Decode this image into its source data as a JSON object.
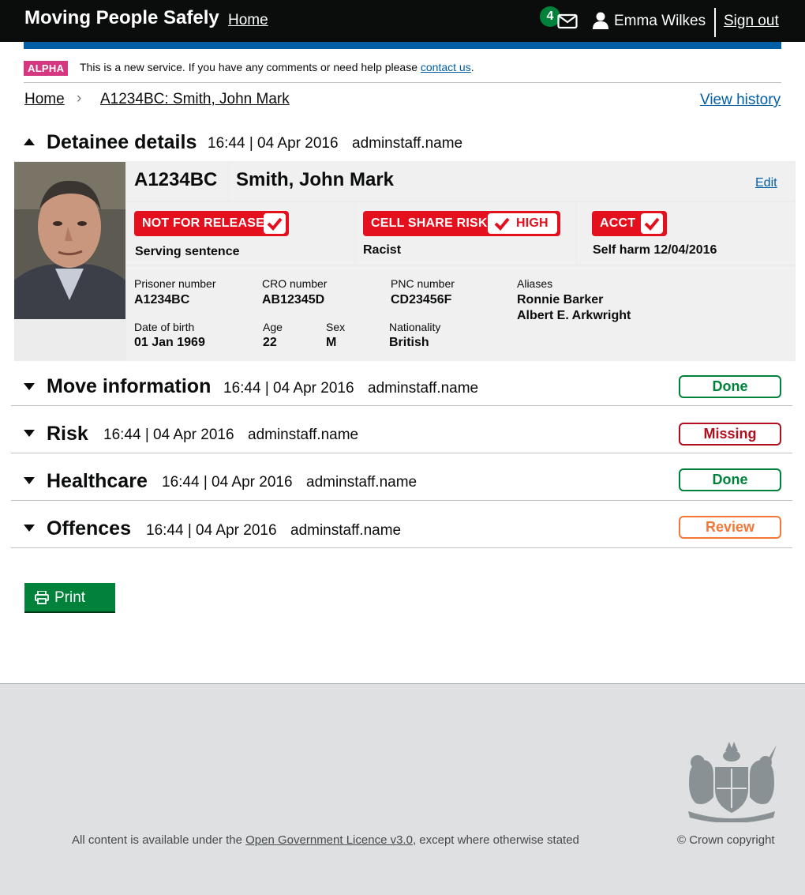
{
  "header": {
    "service_name": "Moving People Safely",
    "home_link": "Home",
    "notification_count": "4",
    "user_name": "Emma Wilkes",
    "sign_out": "Sign out"
  },
  "phase_banner": {
    "tag": "ALPHA",
    "text_before": "This is a new service. If you have any comments or need help please ",
    "link": "contact us",
    "text_after": "."
  },
  "breadcrumb": {
    "home": "Home",
    "current": "A1234BC: Smith, John Mark",
    "view_history": "View history"
  },
  "detainee_section": {
    "title": "Detainee details",
    "timestamp": "16:44 | 04 Apr 2016",
    "user": "adminstaff.name"
  },
  "detainee": {
    "prison_id": "A1234BC",
    "name": "Smith, John Mark",
    "edit": "Edit",
    "alerts": [
      {
        "label": "NOT FOR RELEASE",
        "detail": "Serving sentence"
      },
      {
        "label": "CELL SHARE RISK",
        "level": "HIGH",
        "detail": "Racist"
      },
      {
        "label": "ACCT",
        "detail": "Self harm 12/04/2016"
      }
    ],
    "fields": {
      "prisoner_number": {
        "label": "Prisoner number",
        "value": "A1234BC"
      },
      "cro_number": {
        "label": "CRO number",
        "value": "AB12345D"
      },
      "pnc_number": {
        "label": "PNC number",
        "value": "CD23456F"
      },
      "aliases": {
        "label": "Aliases",
        "values": [
          "Ronnie Barker",
          "Albert E. Arkwright"
        ]
      },
      "date_of_birth": {
        "label": "Date of birth",
        "value": "01 Jan 1969"
      },
      "age": {
        "label": "Age",
        "value": "22"
      },
      "sex": {
        "label": "Sex",
        "value": "M"
      },
      "nationality": {
        "label": "Nationality",
        "value": "British"
      }
    }
  },
  "sections": [
    {
      "title": "Move information",
      "timestamp": "16:44 | 04 Apr 2016",
      "user": "adminstaff.name",
      "status": "Done"
    },
    {
      "title": "Risk",
      "timestamp": "16:44 | 04 Apr 2016",
      "user": "adminstaff.name",
      "status": "Missing"
    },
    {
      "title": "Healthcare",
      "timestamp": "16:44 | 04 Apr 2016",
      "user": "adminstaff.name",
      "status": "Done"
    },
    {
      "title": "Offences",
      "timestamp": "16:44 | 04 Apr 2016",
      "user": "adminstaff.name",
      "status": "Review"
    }
  ],
  "print_button": "Print",
  "footer": {
    "licence_before": "All content is available under the ",
    "licence_link": "Open Government Licence v3.0",
    "licence_after": ", except where otherwise stated",
    "copyright": "© Crown copyright"
  },
  "colors": {
    "header_bg": "#0b0c0c",
    "brand_blue": "#005ea5",
    "alert_red": "#e5101e",
    "done_green": "#00823b",
    "missing_red": "#b10e1e",
    "review_orange": "#f47738",
    "alpha_pink": "#d53880"
  }
}
